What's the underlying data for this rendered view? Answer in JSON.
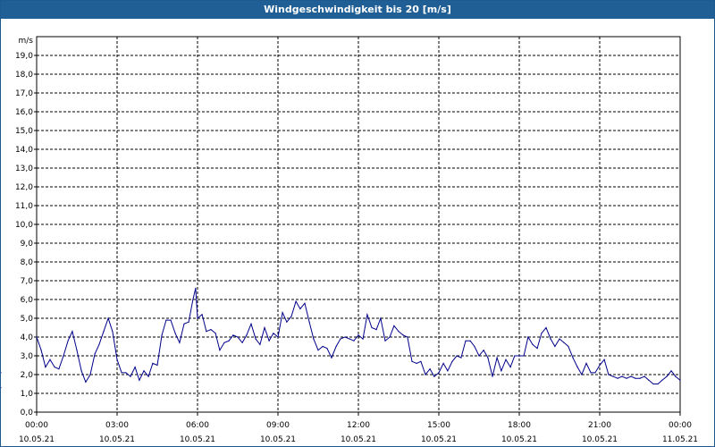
{
  "window": {
    "title": "Windgeschwindigkeit bis 20 [m/s]"
  },
  "colors": {
    "title_bar": "#1f5f96",
    "series_line": "#00008b",
    "grid": "#000000",
    "background": "#ffffff"
  },
  "chart_data": {
    "type": "line",
    "title": "Windgeschwindigkeit bis 20 [m/s]",
    "xlabel": "",
    "ylabel": "m/s",
    "y_unit_label": "m/s",
    "ylim": [
      0,
      20
    ],
    "xlim_hours": [
      0,
      24
    ],
    "grid": true,
    "y_ticks": [
      "0,0",
      "1,0",
      "2,0",
      "3,0",
      "4,0",
      "5,0",
      "6,0",
      "7,0",
      "8,0",
      "9,0",
      "10,0",
      "11,0",
      "12,0",
      "13,0",
      "14,0",
      "15,0",
      "16,0",
      "17,0",
      "18,0",
      "19,0"
    ],
    "x_ticks": [
      {
        "time": "00:00",
        "date": "10.05.21"
      },
      {
        "time": "03:00",
        "date": "10.05.21"
      },
      {
        "time": "06:00",
        "date": "10.05.21"
      },
      {
        "time": "09:00",
        "date": "10.05.21"
      },
      {
        "time": "12:00",
        "date": "10.05.21"
      },
      {
        "time": "15:00",
        "date": "10.05.21"
      },
      {
        "time": "18:00",
        "date": "10.05.21"
      },
      {
        "time": "21:00",
        "date": "10.05.21"
      },
      {
        "time": "00:00",
        "date": "11.05.21"
      }
    ],
    "series": [
      {
        "x_hours": [
          0.0,
          0.17,
          0.33,
          0.5,
          0.67,
          0.83,
          1.0,
          1.17,
          1.33,
          1.5,
          1.67,
          1.83,
          2.0,
          2.17,
          2.33,
          2.5,
          2.67,
          2.83,
          3.0,
          3.17,
          3.33,
          3.5,
          3.67,
          3.83,
          4.0,
          4.17,
          4.33,
          4.5,
          4.67,
          4.83,
          5.0,
          5.17,
          5.33,
          5.5,
          5.67,
          5.83,
          5.93,
          6.0,
          6.17,
          6.33,
          6.5,
          6.67,
          6.83,
          7.0,
          7.17,
          7.33,
          7.5,
          7.67,
          7.83,
          8.0,
          8.17,
          8.33,
          8.5,
          8.67,
          8.83,
          9.0,
          9.17,
          9.33,
          9.5,
          9.67,
          9.83,
          10.0,
          10.17,
          10.33,
          10.5,
          10.67,
          10.83,
          11.0,
          11.17,
          11.33,
          11.5,
          11.67,
          11.83,
          12.0,
          12.17,
          12.33,
          12.5,
          12.67,
          12.83,
          13.0,
          13.17,
          13.33,
          13.5,
          13.67,
          13.83,
          14.0,
          14.17,
          14.33,
          14.5,
          14.67,
          14.83,
          15.0,
          15.17,
          15.33,
          15.5,
          15.67,
          15.83,
          16.0,
          16.17,
          16.33,
          16.5,
          16.67,
          16.83,
          17.0,
          17.17,
          17.33,
          17.5,
          17.67,
          17.83,
          18.0,
          18.17,
          18.33,
          18.5,
          18.67,
          18.83,
          19.0,
          19.17,
          19.33,
          19.5,
          19.67,
          19.83,
          20.0,
          20.17,
          20.33,
          20.5,
          20.67,
          20.83,
          21.0,
          21.17,
          21.33,
          21.5,
          21.67,
          21.83,
          22.0,
          22.17,
          22.33,
          22.5,
          22.67,
          22.83,
          23.0,
          23.17,
          23.33,
          23.5,
          23.67,
          23.83,
          24.0
        ],
        "values": [
          4.0,
          3.3,
          2.4,
          2.8,
          2.4,
          2.3,
          3.0,
          3.8,
          4.3,
          3.3,
          2.2,
          1.6,
          2.0,
          3.1,
          3.6,
          4.3,
          5.0,
          4.3,
          2.8,
          2.1,
          2.1,
          1.9,
          2.4,
          1.7,
          2.2,
          1.9,
          2.6,
          2.5,
          4.1,
          4.9,
          4.9,
          4.2,
          3.7,
          4.7,
          4.8,
          6.0,
          6.6,
          5.0,
          5.2,
          4.3,
          4.4,
          4.2,
          3.3,
          3.7,
          3.8,
          4.1,
          4.0,
          3.7,
          4.1,
          4.7,
          3.9,
          3.6,
          4.5,
          3.8,
          4.2,
          4.0,
          5.3,
          4.8,
          5.1,
          5.9,
          5.5,
          5.8,
          4.8,
          3.9,
          3.3,
          3.5,
          3.4,
          2.9,
          3.5,
          3.9,
          4.0,
          3.9,
          3.8,
          4.1,
          3.9,
          5.2,
          4.5,
          4.4,
          5.0,
          3.8,
          4.0,
          4.6,
          4.3,
          4.1,
          4.0,
          2.7,
          2.6,
          2.7,
          2.0,
          2.3,
          1.9,
          2.1,
          2.6,
          2.2,
          2.7,
          3.0,
          2.9,
          3.8,
          3.8,
          3.5,
          3.0,
          3.3,
          2.9,
          1.9,
          2.9,
          2.2,
          2.8,
          2.4,
          3.0,
          3.0,
          3.0,
          4.0,
          3.6,
          3.4,
          4.2,
          4.5,
          3.9,
          3.5,
          3.9,
          3.7,
          3.5,
          2.9,
          2.4,
          2.0,
          2.6,
          2.1,
          2.1,
          2.5,
          2.8,
          2.0,
          1.9,
          1.8,
          1.9,
          1.8,
          1.9,
          1.8,
          1.8,
          1.9,
          1.7,
          1.5,
          1.5,
          1.7,
          1.9,
          2.2,
          1.9,
          1.7,
          2.1,
          1.3
        ]
      }
    ]
  }
}
